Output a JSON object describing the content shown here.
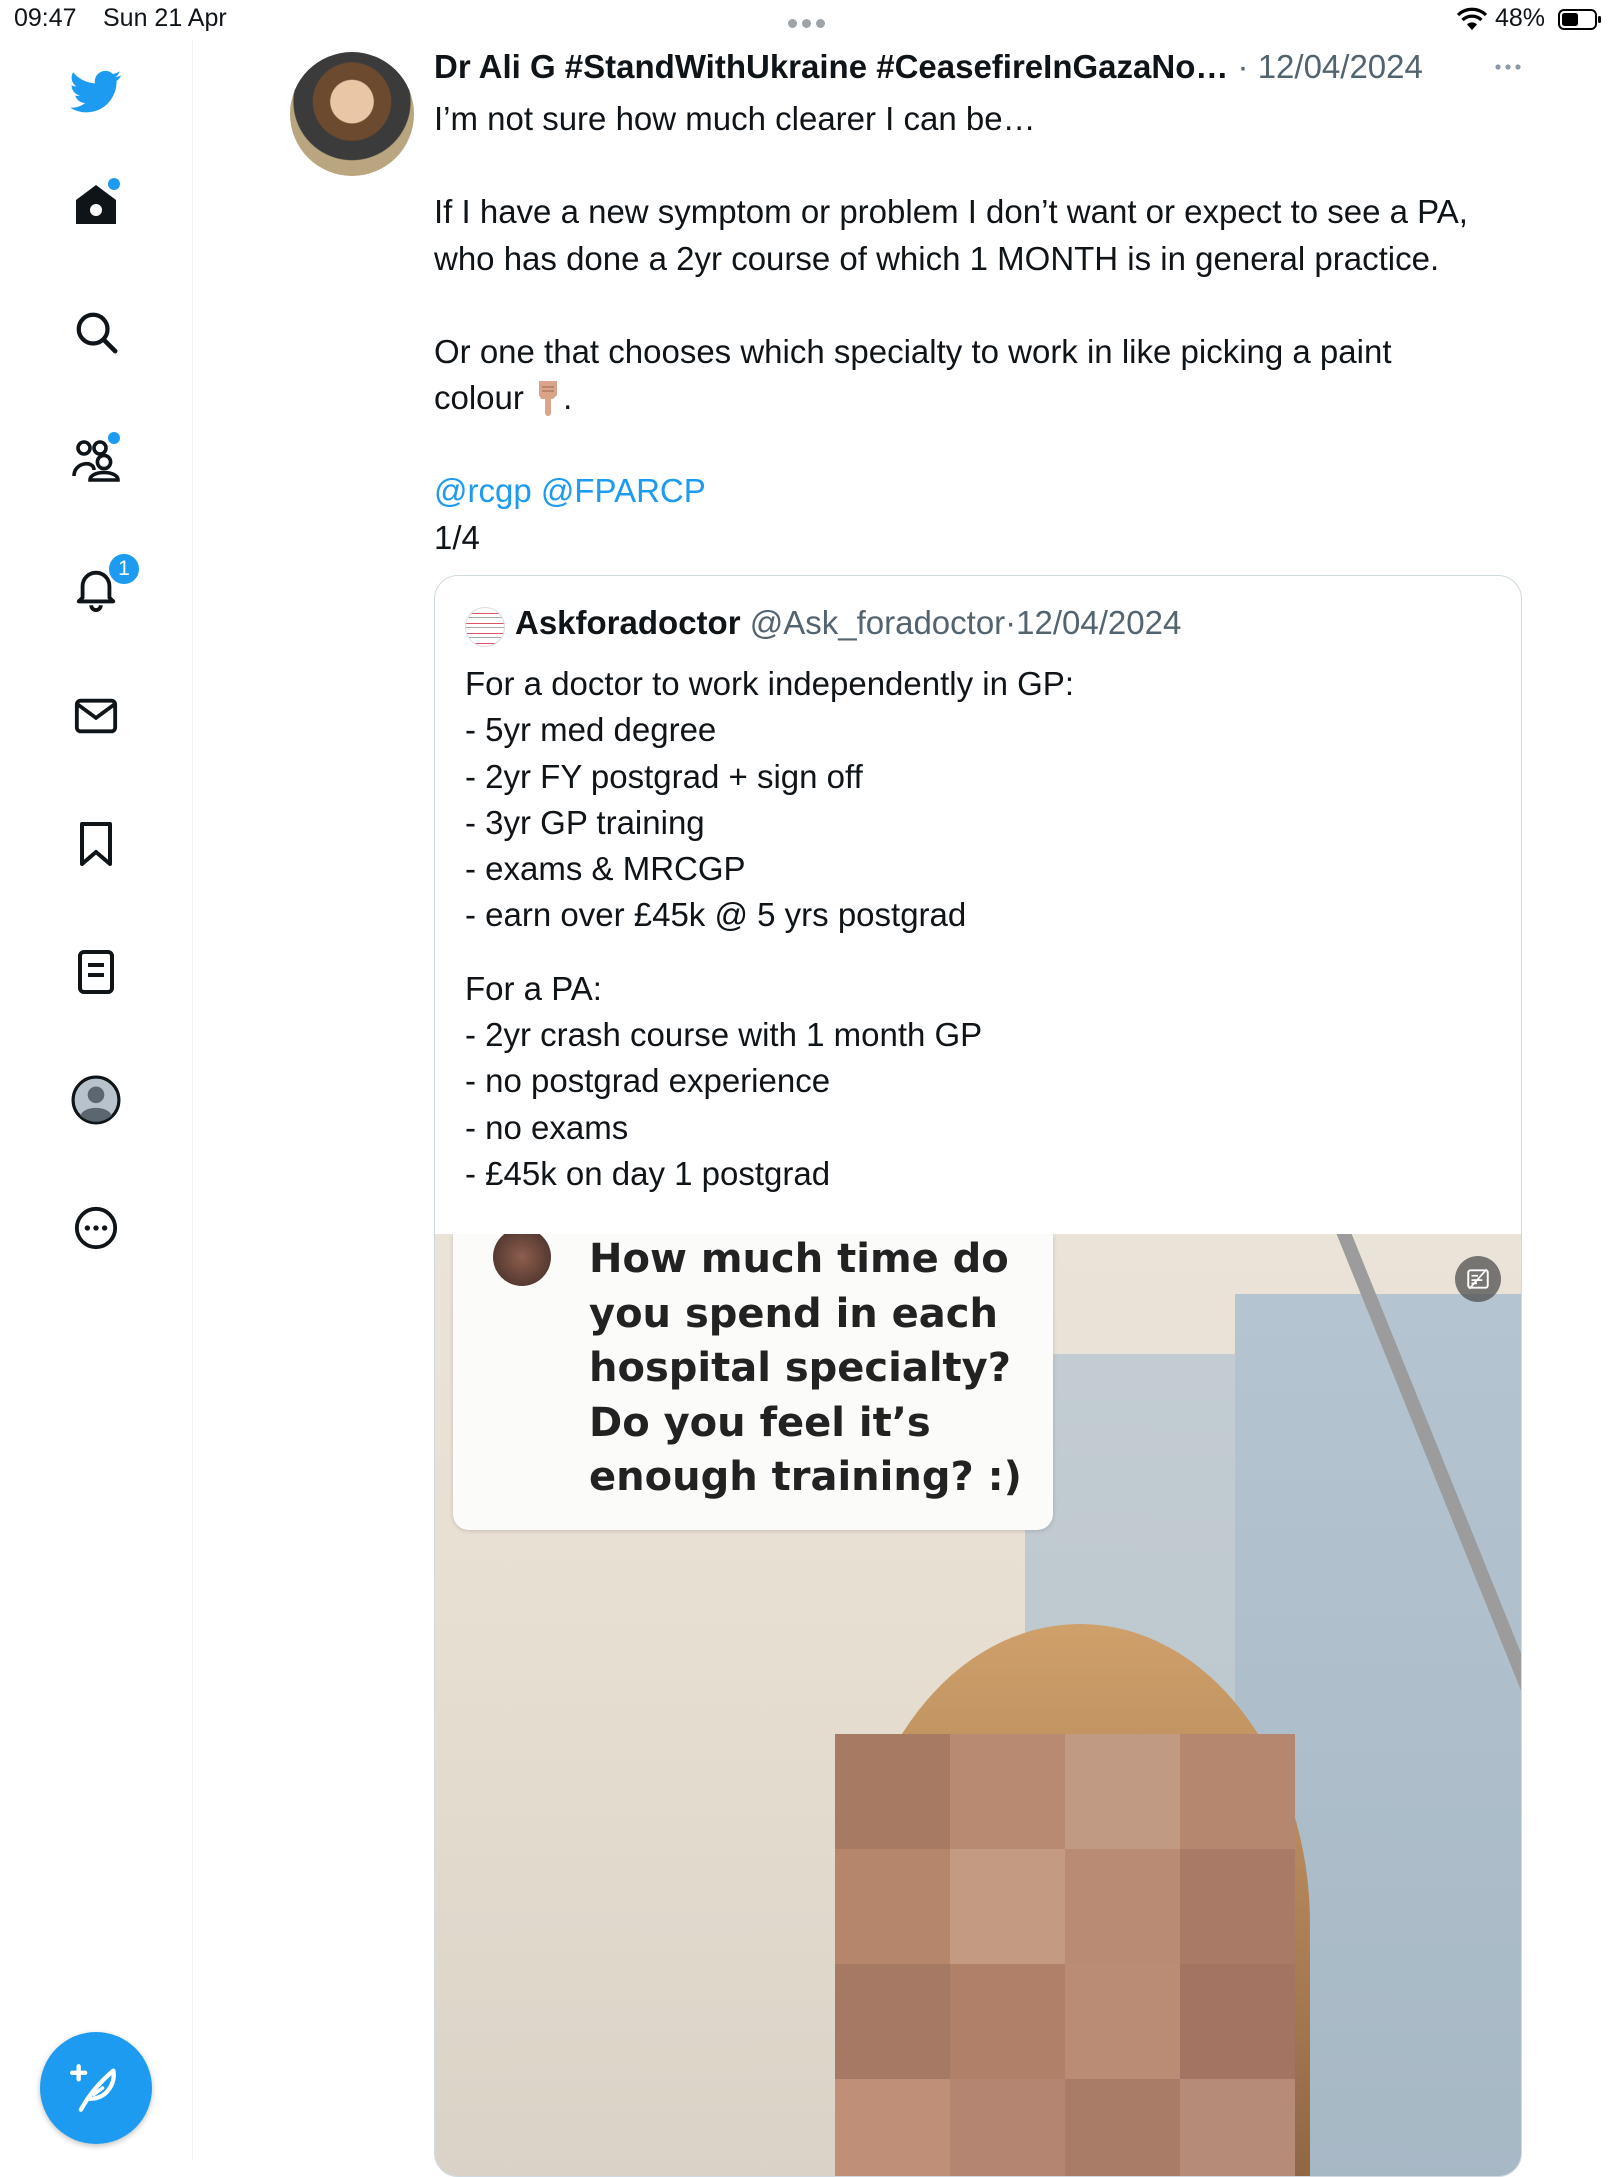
{
  "status_bar": {
    "time": "09:47",
    "date": "Sun 21 Apr",
    "battery": "48%"
  },
  "sidebar": {
    "items": [
      {
        "name": "logo",
        "icon": "twitter-bird-icon"
      },
      {
        "name": "home",
        "icon": "home-icon"
      },
      {
        "name": "explore",
        "icon": "search-icon"
      },
      {
        "name": "communities",
        "icon": "communities-icon"
      },
      {
        "name": "notifications",
        "icon": "bell-icon",
        "badge": "1"
      },
      {
        "name": "messages",
        "icon": "mail-icon"
      },
      {
        "name": "bookmarks",
        "icon": "bookmark-icon"
      },
      {
        "name": "lists",
        "icon": "list-icon"
      },
      {
        "name": "profile",
        "icon": "profile-icon"
      },
      {
        "name": "more",
        "icon": "more-circle-icon"
      }
    ],
    "compose_icon": "compose-feather-icon"
  },
  "tweet": {
    "author": "Dr Ali G #StandWithUkraine #CeasefireInGazaNo…",
    "separator": "·",
    "date": "12/04/2024",
    "more_label": "···",
    "lines": {
      "l1": "I’m not sure how much clearer I can be…",
      "l2": "If I have a new symptom or problem I don’t want or expect to see a PA,",
      "l3": "who has done a 2yr course of which 1 MONTH is in general practice.",
      "l4": "Or one that chooses which specialty to work in like picking a paint",
      "l5": "colour",
      "l5_end": ".",
      "mention1": "@rcgp",
      "mention2": "@FPARCP",
      "counter": "1/4"
    }
  },
  "quote": {
    "name": "Askforadoctor",
    "handle": "@Ask_foradoctor",
    "separator": "·",
    "date": "12/04/2024",
    "lines": [
      "For a doctor to work independently in GP:",
      "- 5yr med degree",
      "- 2yr FY postgrad + sign off",
      "- 3yr GP training",
      "- exams & MRCGP",
      "- earn over £45k @ 5 yrs postgrad",
      "",
      "For a PA:",
      "- 2yr crash course with 1 month GP",
      "- no postgrad experience",
      "- no exams",
      "- £45k on day 1 postgrad"
    ],
    "media": {
      "caption_lines": [
        "How much time do",
        "you spend in each",
        "hospital specialty?",
        "Do you feel it’s",
        "enough training? :)"
      ],
      "corner_icon": "alt-text-icon"
    }
  },
  "colors": {
    "accent": "#1d9bf0",
    "text": "#0f1419",
    "muted": "#536471",
    "border": "#cfd9de"
  }
}
